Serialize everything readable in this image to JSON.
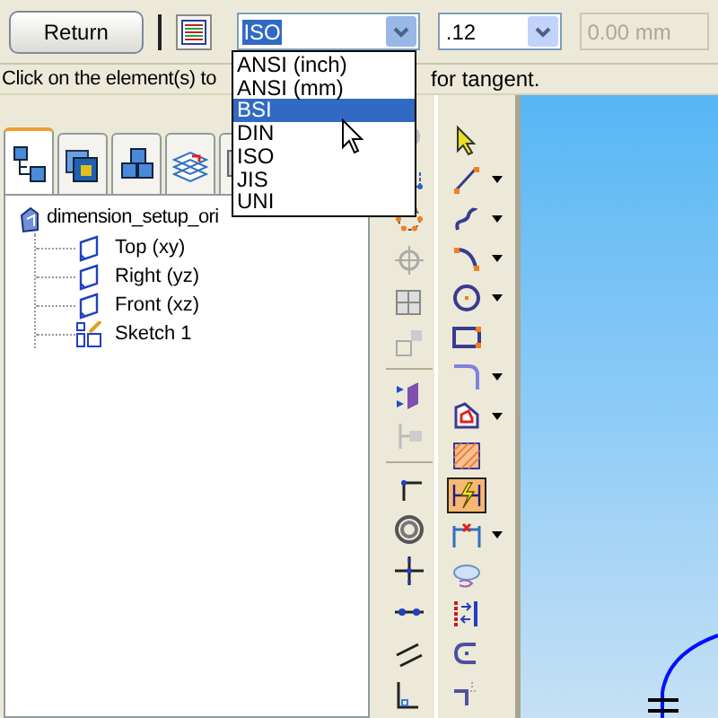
{
  "toolbar": {
    "return_button": "Return",
    "standard_combo": {
      "value": "ISO",
      "expanded": true
    },
    "precision_combo": {
      "value": ".12"
    },
    "distance_field": {
      "value": "0.00 mm",
      "disabled": true
    }
  },
  "status_bar": {
    "text_before": "Click on the element(s) to",
    "text_after": "for tangent."
  },
  "standard_dropdown": {
    "options": [
      {
        "label": "ANSI (inch)",
        "selected": false
      },
      {
        "label": "ANSI (mm)",
        "selected": false
      },
      {
        "label": "BSI",
        "selected": true
      },
      {
        "label": "DIN",
        "selected": false
      },
      {
        "label": "ISO",
        "selected": false
      },
      {
        "label": "JIS",
        "selected": false
      },
      {
        "label": "UNI",
        "selected": false
      }
    ]
  },
  "tabs": [
    {
      "kind": "tree",
      "selected": true
    },
    {
      "kind": "layers",
      "selected": false
    },
    {
      "kind": "parts",
      "selected": false
    },
    {
      "kind": "sheets",
      "selected": false
    },
    {
      "kind": "other",
      "selected": false
    }
  ],
  "tree": {
    "root": {
      "label": "dimension_setup_ori",
      "children": [
        {
          "kind": "plane",
          "label": "Top (xy)"
        },
        {
          "kind": "plane",
          "label": "Right (yz)"
        },
        {
          "kind": "plane",
          "label": "Front (xz)"
        },
        {
          "kind": "sketch",
          "label": "Sketch 1"
        }
      ]
    }
  },
  "draw_tools": [
    {
      "kind": "select",
      "selected": false,
      "has_menu": false
    },
    {
      "kind": "line",
      "selected": false,
      "has_menu": true
    },
    {
      "kind": "curve",
      "selected": false,
      "has_menu": true
    },
    {
      "kind": "arc",
      "selected": false,
      "has_menu": true
    },
    {
      "kind": "circle",
      "selected": false,
      "has_menu": true
    },
    {
      "kind": "rectangle",
      "selected": false,
      "has_menu": false
    },
    {
      "kind": "fillet",
      "selected": false,
      "has_menu": true
    },
    {
      "kind": "fill",
      "selected": false,
      "has_menu": true
    },
    {
      "kind": "hatch",
      "selected": false,
      "has_menu": false
    },
    {
      "kind": "smart-dimension",
      "selected": true,
      "has_menu": false
    },
    {
      "kind": "dimension",
      "selected": false,
      "has_menu": true
    },
    {
      "kind": "annotation",
      "selected": false,
      "has_menu": false
    },
    {
      "kind": "distance",
      "selected": false,
      "has_menu": false
    },
    {
      "kind": "relate",
      "selected": false,
      "has_menu": false
    },
    {
      "kind": "offset",
      "selected": false,
      "has_menu": false
    }
  ]
}
